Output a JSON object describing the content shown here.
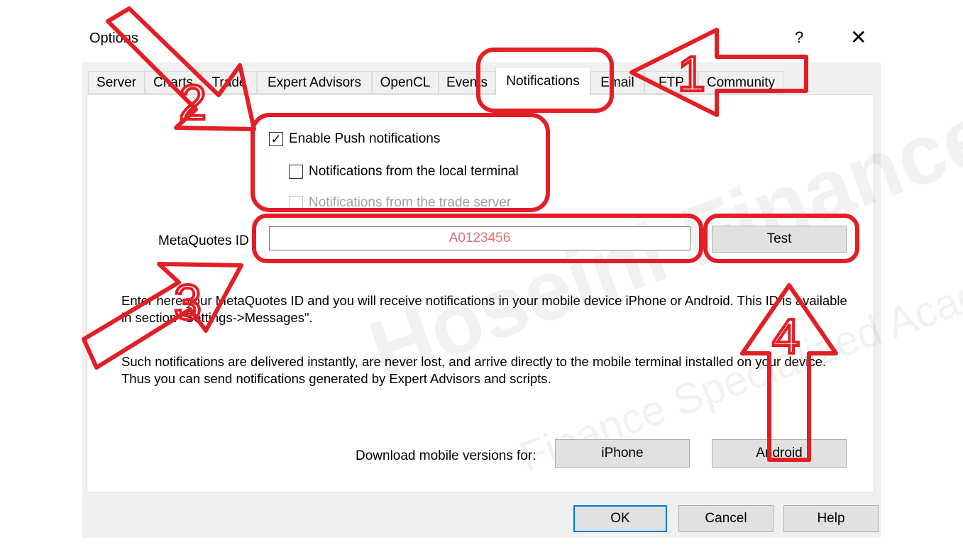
{
  "window": {
    "title": "Options",
    "help": "?",
    "close": "✕"
  },
  "tabs": [
    {
      "label": "Server"
    },
    {
      "label": "Charts"
    },
    {
      "label": "Trade"
    },
    {
      "label": "Expert Advisors"
    },
    {
      "label": "OpenCL"
    },
    {
      "label": "Events"
    },
    {
      "label": "Notifications",
      "active": true
    },
    {
      "label": "Email"
    },
    {
      "label": "FTP"
    },
    {
      "label": "Community"
    }
  ],
  "push": {
    "enable": {
      "label": "Enable Push notifications",
      "checked": true
    },
    "local": {
      "label": "Notifications from the local terminal",
      "checked": false
    },
    "server": {
      "label": "Notifications from the trade server",
      "checked": false,
      "disabled": true
    }
  },
  "metaquotes": {
    "label": "MetaQuotes ID",
    "value": "A0123456",
    "test_label": "Test"
  },
  "info": {
    "p1": "Enter here your MetaQuotes ID and you will receive notifications in your mobile device iPhone or Android. This ID is available in section \"Settings->Messages\".",
    "p2": "Such notifications are delivered instantly, are never lost, and arrive directly to the mobile terminal installed on your device. Thus you can send notifications generated by Expert Advisors and scripts."
  },
  "download": {
    "label": "Download mobile versions for:",
    "iphone": "iPhone",
    "android": "Android"
  },
  "footer": {
    "ok": "OK",
    "cancel": "Cancel",
    "help": "Help"
  },
  "watermark": {
    "line1": "Hoseini Finance",
    "line2": "Finance Specialized Academy"
  },
  "annotations": {
    "n1": "1",
    "n2": "2",
    "n3": "3",
    "n4": "4",
    "color": "#e31e24"
  },
  "colors": {
    "highlight_red": "#e31e24",
    "accent_blue": "#0078d7",
    "id_text": "#e07070"
  }
}
